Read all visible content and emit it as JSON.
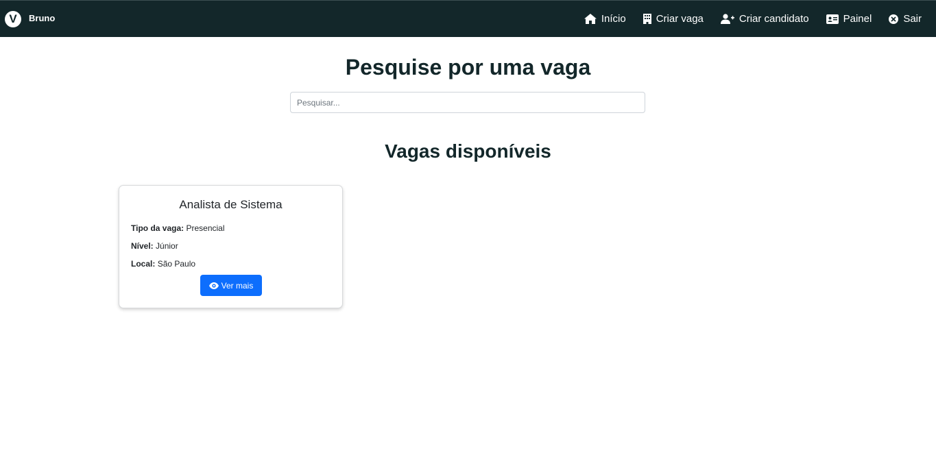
{
  "navbar": {
    "brand_letter": "V",
    "brand_name": "Bruno",
    "background": "#13272a",
    "items": [
      {
        "label": "Início",
        "icon": "home-icon"
      },
      {
        "label": "Criar vaga",
        "icon": "building-icon"
      },
      {
        "label": "Criar candidato",
        "icon": "user-plus-icon"
      },
      {
        "label": "Painel",
        "icon": "id-card-icon"
      },
      {
        "label": "Sair",
        "icon": "circle-x-icon"
      }
    ]
  },
  "main": {
    "title": "Pesquise por uma vaga",
    "search": {
      "placeholder": "Pesquisar...",
      "value": ""
    },
    "section_title": "Vagas disponíveis"
  },
  "jobs": [
    {
      "title": "Analista de Sistema",
      "type_label": "Tipo da vaga:",
      "type_value": "Presencial",
      "level_label": "Nível:",
      "level_value": "Júnior",
      "location_label": "Local:",
      "location_value": "São Paulo",
      "button_label": "Ver mais",
      "button_icon": "eye-icon",
      "button_color": "#0d6efd"
    }
  ]
}
